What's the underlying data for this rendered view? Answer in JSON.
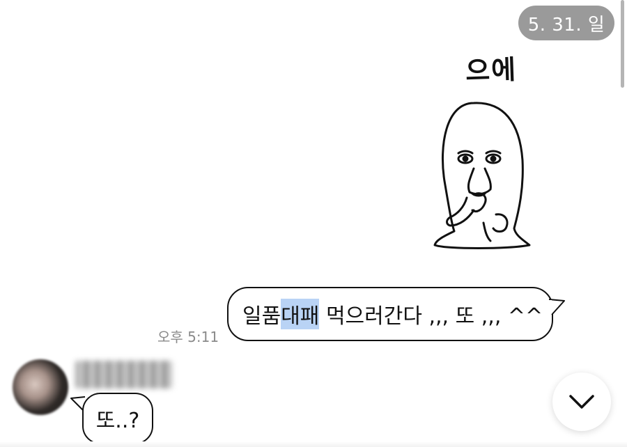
{
  "date_divider": {
    "label": "5. 31. 일"
  },
  "sticker": {
    "caption": "으에",
    "icon": "blob-character-sticker-icon"
  },
  "outgoing_message": {
    "text_before": "일품",
    "text_highlighted": "대패",
    "text_after": " 먹으러간다 ,,, 또 ,,, ^^",
    "time": "오후 5:11",
    "highlight_color": "#b9d3f5"
  },
  "incoming_message": {
    "text": "또..?"
  },
  "controls": {
    "scroll_down_icon": "chevron-down-icon"
  }
}
